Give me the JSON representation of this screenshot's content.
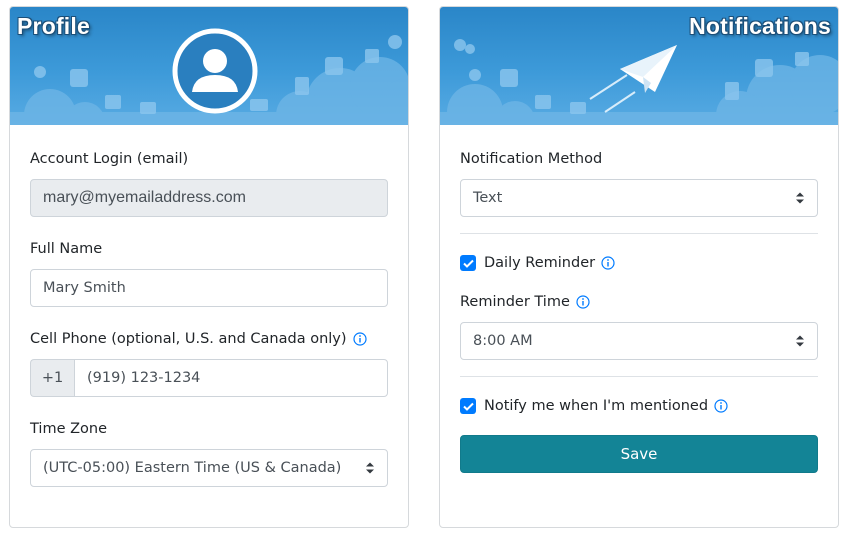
{
  "profile": {
    "title": "Profile",
    "account_login_label": "Account Login (email)",
    "account_login_value": "mary@myemailaddress.com",
    "full_name_label": "Full Name",
    "full_name_value": "Mary Smith",
    "cell_phone_label": "Cell Phone (optional, U.S. and Canada only)",
    "cell_phone_prefix": "+1",
    "cell_phone_value": "(919) 123-1234",
    "time_zone_label": "Time Zone",
    "time_zone_value": "(UTC-05:00) Eastern Time (US & Canada)"
  },
  "notifications": {
    "title": "Notifications",
    "method_label": "Notification Method",
    "method_value": "Text",
    "daily_reminder_label": "Daily Reminder",
    "daily_reminder_checked": true,
    "reminder_time_label": "Reminder Time",
    "reminder_time_value": "8:00 AM",
    "notify_mentioned_label": "Notify me when I'm mentioned",
    "notify_mentioned_checked": true,
    "save_label": "Save"
  },
  "colors": {
    "banner": "#3d9ad9",
    "accent": "#007bff",
    "save_button": "#138496"
  },
  "icons": [
    "user-avatar-icon",
    "paper-plane-icon",
    "info-icon",
    "select-caret-icon",
    "check-icon"
  ]
}
